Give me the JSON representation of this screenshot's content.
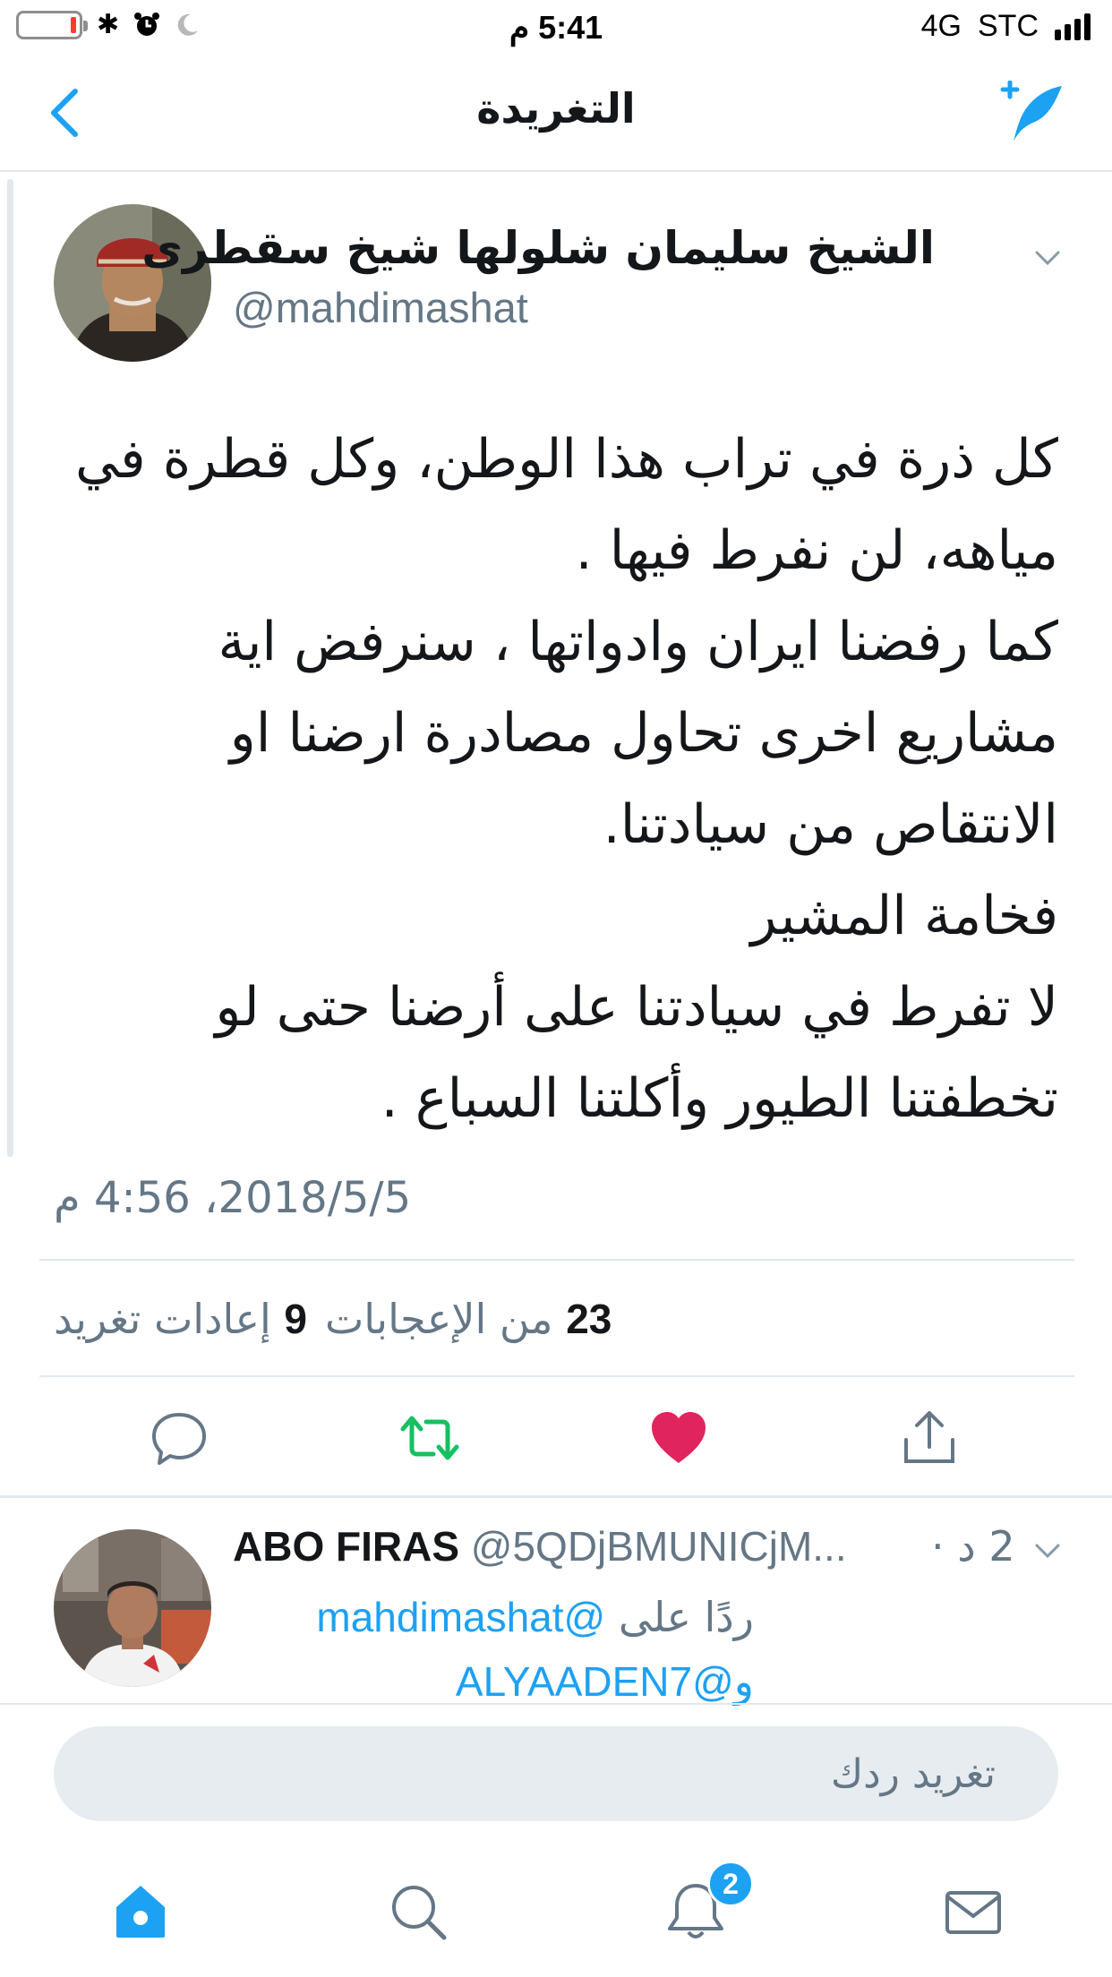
{
  "status_bar": {
    "time": "5:41 م",
    "network": "4G",
    "carrier": "STC",
    "battery_level": 0.1
  },
  "nav": {
    "title": "التغريدة"
  },
  "tweet": {
    "author_name": "الشيخ سليمان شلولها شيخ سقطرى",
    "author_handle": "@mahdimashat",
    "lines": [
      "كل ذرة في تراب  هذا الوطن، وكل قطرة في",
      "مياهه، لن نفرط فيها .",
      "كما رفضنا ايران وادواتها ، سنرفض اية",
      "مشاريع اخرى تحاول مصادرة ارضنا او",
      "الانتقاص من سيادتنا.",
      "فخامة المشير",
      "لا تفرط في سيادتنا على أرضنا حتى لو",
      "تخطفتنا الطيور وأكلتنا السباع ."
    ],
    "timestamp": "2018/5/5، 4:56 م",
    "likes_count": "23",
    "likes_label": "من الإعجابات",
    "retweets_count": "9",
    "retweets_label": "إعادات تغريد"
  },
  "reply": {
    "author_name": "ABO FIRAS",
    "author_handle": "@5QDjBMUNICjM...",
    "time": "2 د ·",
    "reply_to_prefix": "ردًا على",
    "mention_1": "@mahdimashat",
    "mention_2": "و@ALYAADEN7"
  },
  "composer": {
    "placeholder": "تغريد ردك"
  },
  "tab_bar": {
    "notifications_badge": "2"
  },
  "colors": {
    "accent": "#1da1f2",
    "retweet": "#17bf63",
    "like": "#e0245e",
    "secondary_text": "#657786",
    "divider": "#e1e8ed"
  }
}
